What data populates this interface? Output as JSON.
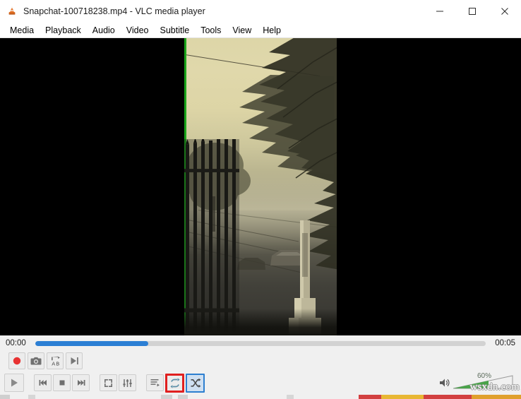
{
  "window": {
    "title": "Snapchat-100718238.mp4 - VLC media player",
    "app_icon": "vlc-cone-icon",
    "controls": {
      "minimize": "minimize-icon",
      "maximize": "maximize-icon",
      "close": "close-icon"
    }
  },
  "menubar": {
    "items": [
      {
        "label": "Media"
      },
      {
        "label": "Playback"
      },
      {
        "label": "Audio"
      },
      {
        "label": "Video"
      },
      {
        "label": "Subtitle"
      },
      {
        "label": "Tools"
      },
      {
        "label": "View"
      },
      {
        "label": "Help"
      }
    ]
  },
  "video": {
    "description": "Sepia-toned foggy street scene with tall trees, overhead power lines, an iron gate fence in the foreground and a stone post",
    "letterbox_color": "#000000",
    "left_edge_marker_color": "#19a319"
  },
  "seek": {
    "elapsed": "00:00",
    "duration": "00:05",
    "progress_percent": 25,
    "fill_color": "#2c7fd4",
    "track_color": "#d2d2d2"
  },
  "advanced_controls": [
    {
      "name": "record-button",
      "icon": "record-icon",
      "label": "Record"
    },
    {
      "name": "snapshot-button",
      "icon": "camera-icon",
      "label": "Take Snapshot"
    },
    {
      "name": "ab-loop-button",
      "icon": "ab-loop-icon",
      "label": "Loop from A to B"
    },
    {
      "name": "frame-by-frame-button",
      "icon": "frame-step-icon",
      "label": "Frame by Frame"
    }
  ],
  "playback_controls": {
    "play": {
      "icon": "play-icon",
      "label": "Play"
    },
    "previous": {
      "icon": "previous-icon",
      "label": "Previous"
    },
    "stop": {
      "icon": "stop-icon",
      "label": "Stop"
    },
    "next": {
      "icon": "next-icon",
      "label": "Next"
    },
    "fullscreen": {
      "icon": "fullscreen-icon",
      "label": "Toggle fullscreen"
    },
    "extended_settings": {
      "icon": "equalizer-icon",
      "label": "Show extended settings"
    },
    "playlist": {
      "icon": "playlist-icon",
      "label": "Show playlist"
    },
    "loop": {
      "icon": "loop-icon",
      "label": "Click to toggle between loop all, loop one and no loop",
      "highlight": "red"
    },
    "shuffle": {
      "icon": "shuffle-icon",
      "label": "Random",
      "highlight": "blue"
    }
  },
  "volume": {
    "icon": "speaker-icon",
    "level_label": "60%",
    "level_percent": 60,
    "fill_color": "#49a349"
  },
  "watermark": {
    "text": "wsxdn.com"
  },
  "colors": {
    "toolbar_background": "#f0f0f0",
    "titlebar_background": "#ffffff",
    "highlight_red": "#e02020",
    "highlight_blue": "#2d7fd0",
    "seek_fill": "#2c7fd4",
    "volume_green": "#49a349"
  }
}
